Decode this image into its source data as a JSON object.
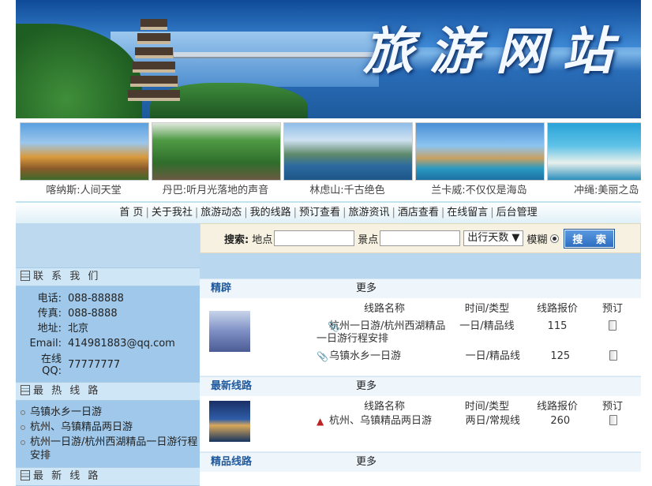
{
  "banner": {
    "title": "旅游网站"
  },
  "photos": [
    {
      "caption": "喀纳斯:人间天堂"
    },
    {
      "caption": "丹巴:听月光落地的声音"
    },
    {
      "caption": "林虑山:千古绝色"
    },
    {
      "caption": "兰卡威:不仅仅是海岛"
    },
    {
      "caption": "冲绳:美丽之岛"
    }
  ],
  "nav": [
    "首 页",
    "关于我社",
    "旅游动态",
    "我的线路",
    "预订查看",
    "旅游资讯",
    "酒店查看",
    "在线留言",
    "后台管理"
  ],
  "search": {
    "label": "搜索:",
    "location": "地点",
    "spot": "景点",
    "days": "出行天数 ▼",
    "fuzzy": "模糊",
    "button": "搜 索"
  },
  "sidebar": {
    "contact_title": "联 系 我 们",
    "contact": [
      {
        "k": "电话:",
        "v": "088-88888"
      },
      {
        "k": "传真:",
        "v": "088-8888"
      },
      {
        "k": "地址:",
        "v": "北京"
      },
      {
        "k": "Email:",
        "v": "414981883@qq.com"
      },
      {
        "k": "在线QQ:",
        "v": "77777777"
      }
    ],
    "hot_title": "最 热 线 路",
    "hot": [
      "乌镇水乡一日游",
      "杭州、乌镇精品两日游",
      "杭州一日游/杭州西湖精品一日游行程安排"
    ],
    "new_title": "最 新 线 路"
  },
  "sections": [
    {
      "title": "精辟",
      "more": "更多",
      "headers": {
        "name": "线路名称",
        "type": "时间/类型",
        "price": "线路报价",
        "book": "预订"
      },
      "rows": [
        {
          "name": "杭州一日游/杭州西湖精品一日游行程安排",
          "type": "一日/精品线",
          "price": "115"
        },
        {
          "name": "乌镇水乡一日游",
          "type": "一日/精品线",
          "price": "125"
        }
      ]
    },
    {
      "title": "最新线路",
      "more": "更多",
      "headers": {
        "name": "线路名称",
        "type": "时间/类型",
        "price": "线路报价",
        "book": "预订"
      },
      "rows": [
        {
          "name": "杭州、乌镇精品两日游",
          "type": "两日/常规线",
          "price": "260"
        }
      ]
    },
    {
      "title": "精品线路",
      "more": "更多"
    }
  ]
}
